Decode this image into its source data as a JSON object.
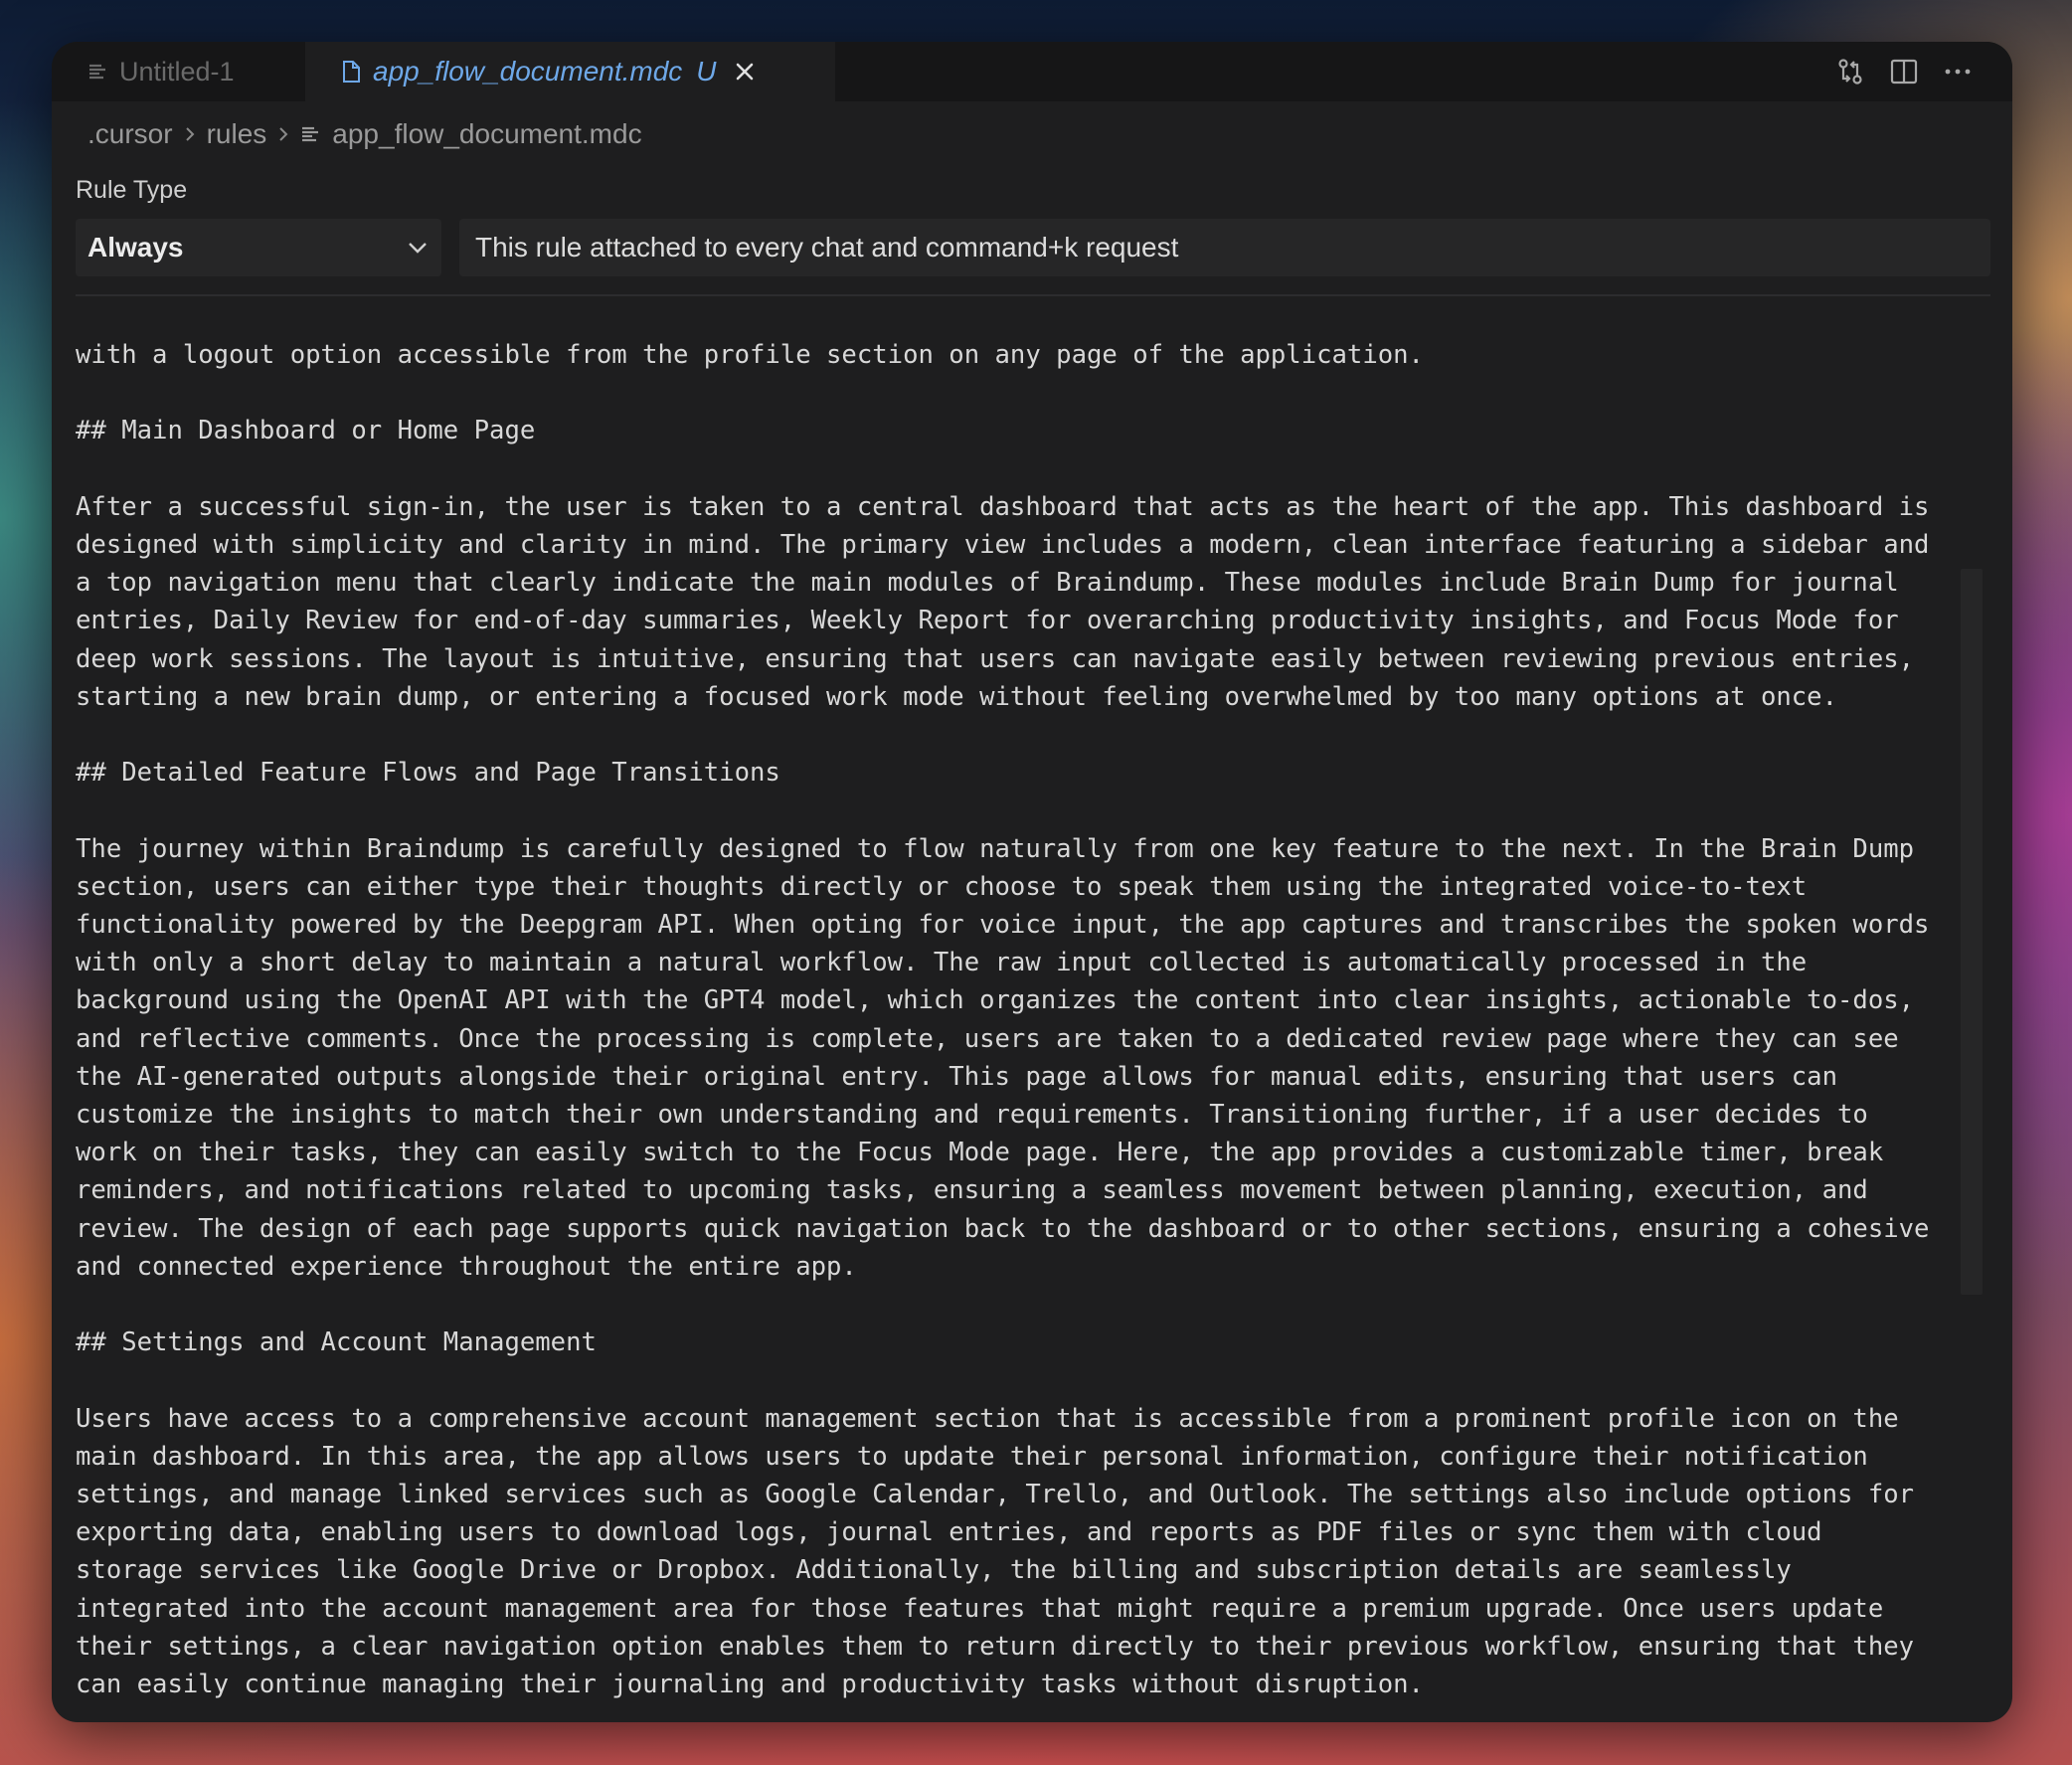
{
  "tabs": [
    {
      "label": "Untitled-1",
      "active": false
    },
    {
      "label": "app_flow_document.mdc",
      "modified": "U",
      "active": true
    }
  ],
  "breadcrumb": {
    "parts": [
      ".cursor",
      "rules",
      "app_flow_document.mdc"
    ]
  },
  "rule": {
    "label": "Rule Type",
    "selected": "Always",
    "description": "This rule attached to every chat and command+k request"
  },
  "editor_lines": [
    "with a logout option accessible from the profile section on any page of the application.",
    "",
    "## Main Dashboard or Home Page",
    "",
    "After a successful sign-in, the user is taken to a central dashboard that acts as the heart of the app. This dashboard is",
    "designed with simplicity and clarity in mind. The primary view includes a modern, clean interface featuring a sidebar and",
    "a top navigation menu that clearly indicate the main modules of Braindump. These modules include Brain Dump for journal",
    "entries, Daily Review for end-of-day summaries, Weekly Report for overarching productivity insights, and Focus Mode for",
    "deep work sessions. The layout is intuitive, ensuring that users can navigate easily between reviewing previous entries,",
    "starting a new brain dump, or entering a focused work mode without feeling overwhelmed by too many options at once.",
    "",
    "## Detailed Feature Flows and Page Transitions",
    "",
    "The journey within Braindump is carefully designed to flow naturally from one key feature to the next. In the Brain Dump",
    "section, users can either type their thoughts directly or choose to speak them using the integrated voice-to-text",
    "functionality powered by the Deepgram API. When opting for voice input, the app captures and transcribes the spoken words",
    "with only a short delay to maintain a natural workflow. The raw input collected is automatically processed in the",
    "background using the OpenAI API with the GPT4 model, which organizes the content into clear insights, actionable to-dos,",
    "and reflective comments. Once the processing is complete, users are taken to a dedicated review page where they can see",
    "the AI-generated outputs alongside their original entry. This page allows for manual edits, ensuring that users can",
    "customize the insights to match their own understanding and requirements. Transitioning further, if a user decides to",
    "work on their tasks, they can easily switch to the Focus Mode page. Here, the app provides a customizable timer, break",
    "reminders, and notifications related to upcoming tasks, ensuring a seamless movement between planning, execution, and",
    "review. The design of each page supports quick navigation back to the dashboard or to other sections, ensuring a cohesive",
    "and connected experience throughout the entire app.",
    "",
    "## Settings and Account Management",
    "",
    "Users have access to a comprehensive account management section that is accessible from a prominent profile icon on the",
    "main dashboard. In this area, the app allows users to update their personal information, configure their notification",
    "settings, and manage linked services such as Google Calendar, Trello, and Outlook. The settings also include options for",
    "exporting data, enabling users to download logs, journal entries, and reports as PDF files or sync them with cloud",
    "storage services like Google Drive or Dropbox. Additionally, the billing and subscription details are seamlessly",
    "integrated into the account management area for those features that might require a premium upgrade. Once users update",
    "their settings, a clear navigation option enables them to return directly to their previous workflow, ensuring that they",
    "can easily continue managing their journaling and productivity tasks without disruption."
  ],
  "colors": {
    "window_bg": "#1e1e1f",
    "tabbar_bg": "#161617",
    "active_tab_text": "#6ea8e8",
    "editor_text": "#d8d8d8"
  }
}
